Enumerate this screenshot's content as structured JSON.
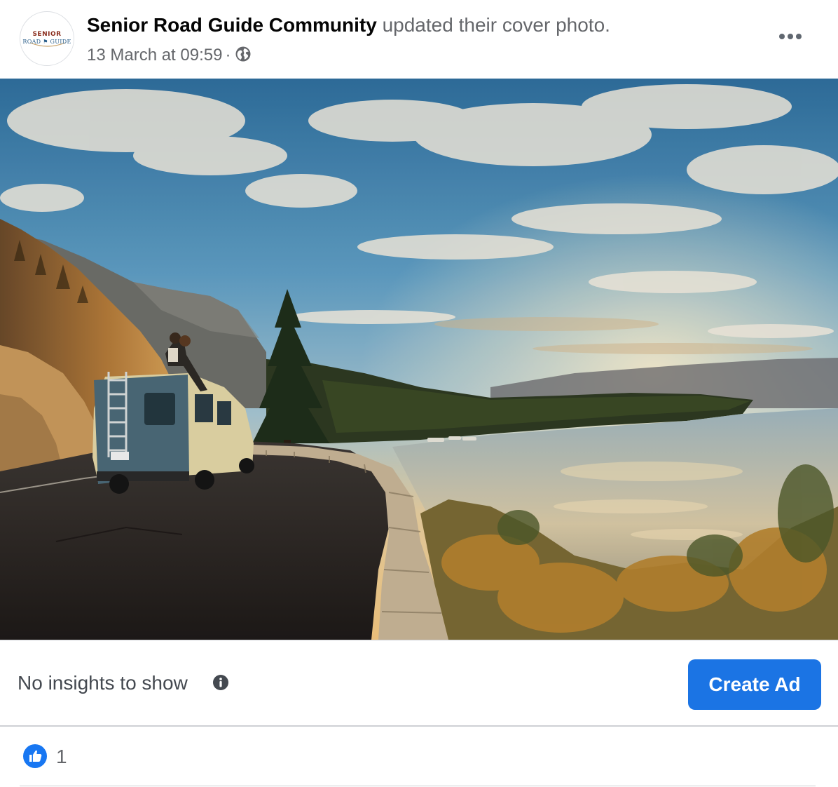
{
  "post": {
    "page_name": "Senior Road Guide Community",
    "action": "updated their cover photo.",
    "timestamp": "13 March at 09:59",
    "separator": "·",
    "audience_icon": "globe-icon",
    "more_icon": "more-dots-icon"
  },
  "avatar": {
    "line1": "SENIOR",
    "line2": "ROAD ⚑ GUIDE"
  },
  "insights": {
    "text": "No insights to show",
    "info_icon": "info-icon",
    "button_label": "Create Ad"
  },
  "reactions": {
    "icon": "like-icon",
    "count": "1"
  },
  "colors": {
    "brand_blue": "#1b74e4",
    "secondary_text": "#65676b",
    "divider": "#ced0d4"
  }
}
